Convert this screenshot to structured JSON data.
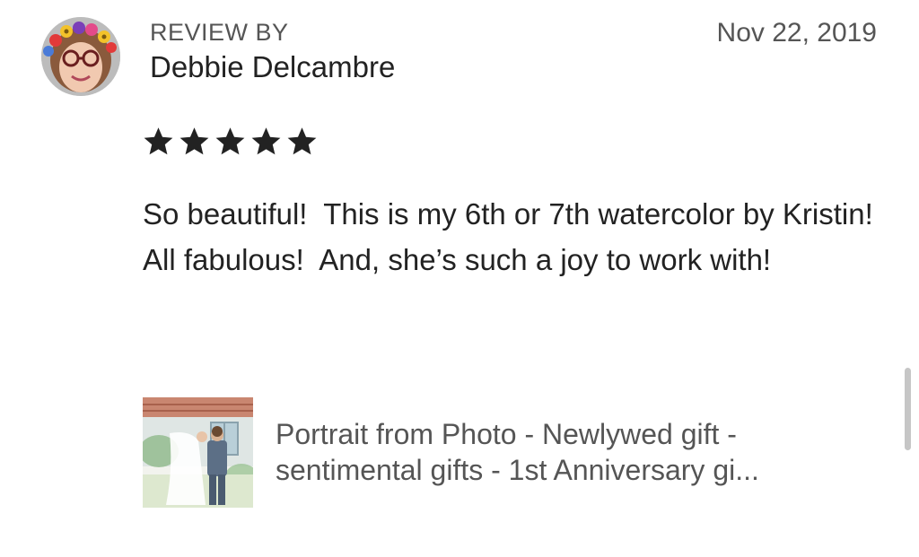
{
  "review": {
    "header_label": "REVIEW BY",
    "reviewer_name": "Debbie Delcambre",
    "date": "Nov 22, 2019",
    "rating": 5,
    "rating_max": 5,
    "text": "So beautiful!  This is my 6th or 7th watercolor by Kristin!  All fabulous!  And, she’s such a joy to work with!"
  },
  "product": {
    "title_line1": "Portrait from Photo - Newlywed gift -",
    "title_line2": "sentimental gifts - 1st Anniversary gi..."
  },
  "icons": {
    "star": "star-icon",
    "avatar": "reviewer-avatar",
    "thumbnail": "product-thumbnail"
  },
  "colors": {
    "star": "#222222",
    "text": "#222222",
    "muted": "#555555",
    "scrollbar": "#c6c6c6"
  }
}
